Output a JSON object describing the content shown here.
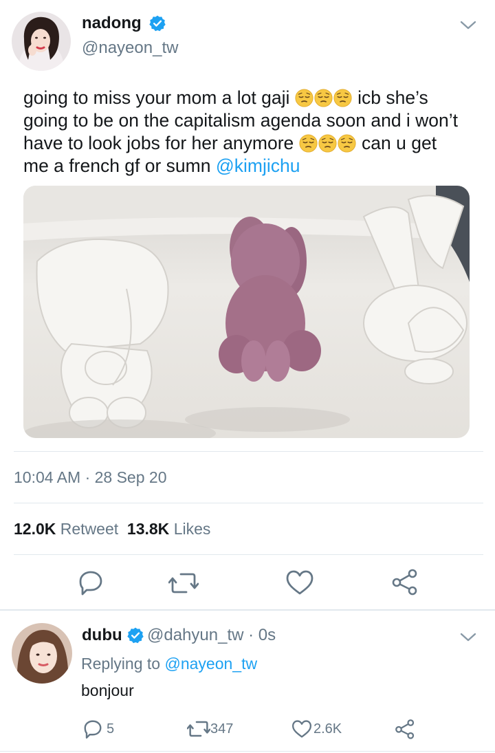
{
  "tweet": {
    "display_name": "nadong",
    "handle": "@nayeon_tw",
    "text_parts": {
      "line1": "going to miss your mom a lot gaji",
      "line1b": "icb she’s",
      "line2": "going to be on the capitalism agenda soon and i won’t",
      "line3": "have to look jobs for her anymore",
      "line3b": "can u get",
      "line4": "me a french gf or sumn",
      "mention": "@kimjichu"
    },
    "emoji": "pensive-face-emoji",
    "timestamp": "10:04 AM · 28 Sep 20",
    "retweets_count": "12.0K",
    "retweets_label": "Retweet",
    "likes_count": "13.8K",
    "likes_label": "Likes"
  },
  "reply": {
    "display_name": "dubu",
    "handle_time": "@dahyun_tw · 0s",
    "replying_label": "Replying to",
    "replying_to": "@nayeon_tw",
    "text": "bonjour",
    "reply_count": "5",
    "retweet_count": "347",
    "like_count": "2.6K"
  },
  "colors": {
    "accent": "#1da1f2",
    "secondary_text": "#657786",
    "icon": "#657786",
    "divider": "#e1e8ed"
  },
  "icons": [
    "verified-badge-icon",
    "chevron-down-icon",
    "reply-icon",
    "retweet-icon",
    "like-icon",
    "share-icon"
  ]
}
